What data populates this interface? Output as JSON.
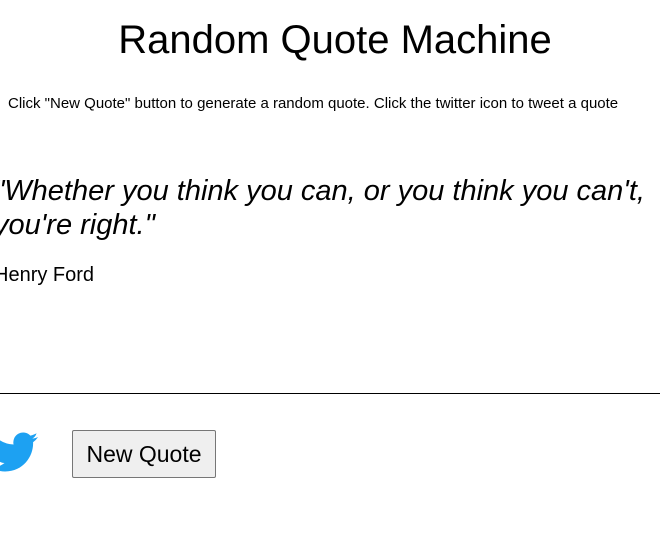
{
  "header": {
    "title": "Random Quote Machine",
    "instructions": "Click \"New Quote\" button to generate a random quote. Click the twitter icon to tweet a quote"
  },
  "quote": {
    "text": "\"Whether you think you can, or you think you can't, you're right.\"",
    "author": "Henry Ford"
  },
  "actions": {
    "tweet_icon": "twitter-bird-icon",
    "new_quote_label": "New Quote"
  },
  "colors": {
    "twitter_blue": "#1DA1F2",
    "button_bg": "#efefef",
    "text": "#000000"
  }
}
